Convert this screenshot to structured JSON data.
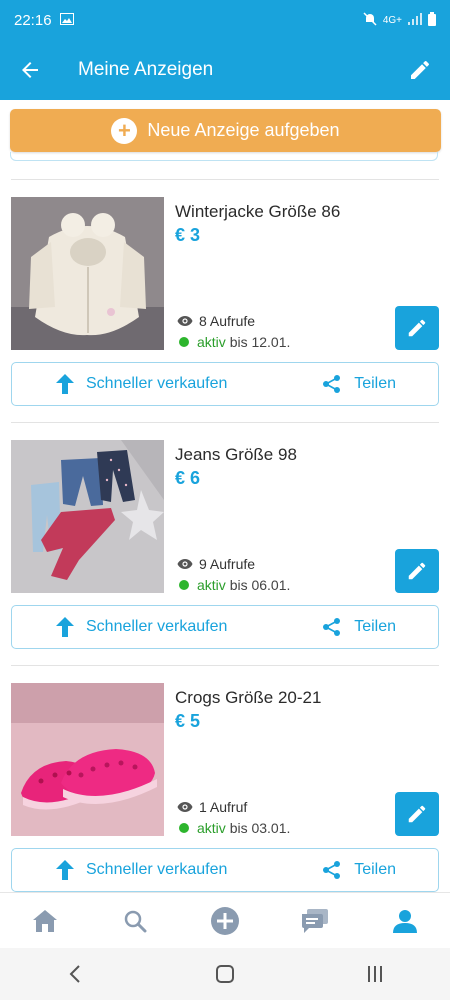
{
  "status_bar": {
    "time": "22:16",
    "network": "4G+"
  },
  "app_bar": {
    "title": "Meine Anzeigen"
  },
  "new_ad_label": "Neue Anzeige aufgeben",
  "ads": [
    {
      "title": "Winterjacke Größe 86",
      "price": "€ 3",
      "views": "8 Aufrufe",
      "status": "aktiv",
      "until": "bis 12.01.",
      "sell_label": "Schneller verkaufen",
      "share_label": "Teilen"
    },
    {
      "title": "Jeans Größe 98",
      "price": "€ 6",
      "views": "9 Aufrufe",
      "status": "aktiv",
      "until": "bis 06.01.",
      "sell_label": "Schneller verkaufen",
      "share_label": "Teilen"
    },
    {
      "title": "Crogs Größe 20-21",
      "price": "€ 5",
      "views": "1 Aufruf",
      "status": "aktiv",
      "until": "bis 03.01.",
      "sell_label": "Schneller verkaufen",
      "share_label": "Teilen"
    }
  ],
  "bottom_nav": {
    "items": [
      {
        "icon": "home-icon",
        "active": false
      },
      {
        "icon": "search-icon",
        "active": false
      },
      {
        "icon": "add-circle-icon",
        "active": false
      },
      {
        "icon": "messages-icon",
        "active": false
      },
      {
        "icon": "profile-icon",
        "active": true
      }
    ]
  },
  "colors": {
    "primary": "#19a3dc",
    "accent": "#f0ac52",
    "active_status": "#2b9e2b",
    "nav_inactive": "#8a9bb0"
  }
}
